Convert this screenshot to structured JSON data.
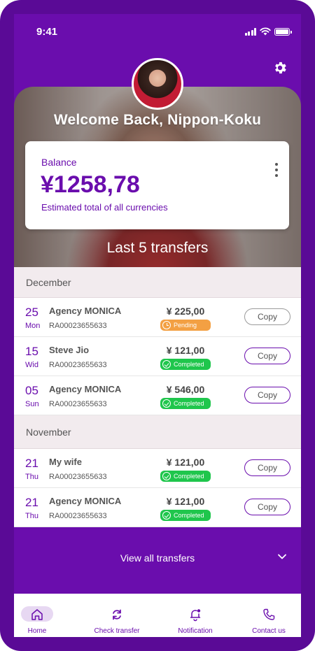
{
  "status_bar": {
    "time": "9:41"
  },
  "header": {
    "welcome": "Welcome Back, Nippon-Koku"
  },
  "balance": {
    "label": "Balance",
    "amount": "¥1258,78",
    "subtitle": "Estimated total of all currencies"
  },
  "transfers_title": "Last 5 transfers",
  "groups": [
    {
      "month": "December",
      "items": [
        {
          "day": "25",
          "weekday": "Mon",
          "name": "Agency MONICA",
          "ref": "RA00023655633",
          "amount": "¥ 225,00",
          "status": "Pending",
          "copy": "Copy"
        },
        {
          "day": "15",
          "weekday": "Wid",
          "name": "Steve Jio",
          "ref": "RA00023655633",
          "amount": "¥ 121,00",
          "status": "Completed",
          "copy": "Copy"
        },
        {
          "day": "05",
          "weekday": "Sun",
          "name": "Agency MONICA",
          "ref": "RA00023655633",
          "amount": "¥ 546,00",
          "status": "Completed",
          "copy": "Copy"
        }
      ]
    },
    {
      "month": "November",
      "items": [
        {
          "day": "21",
          "weekday": "Thu",
          "name": "My wife",
          "ref": "RA00023655633",
          "amount": "¥ 121,00",
          "status": "Completed",
          "copy": "Copy"
        },
        {
          "day": "21",
          "weekday": "Thu",
          "name": "Agency MONICA",
          "ref": "RA00023655633",
          "amount": "¥ 121,00",
          "status": "Completed",
          "copy": "Copy"
        }
      ]
    }
  ],
  "view_all": "View all transfers",
  "tabs": [
    {
      "label": "Home",
      "icon": "home-icon",
      "active": true
    },
    {
      "label": "Check transfer",
      "icon": "exchange-icon",
      "active": false
    },
    {
      "label": "Notification",
      "icon": "bell-icon",
      "active": false
    },
    {
      "label": "Contact us",
      "icon": "phone-icon",
      "active": false
    }
  ],
  "colors": {
    "brand": "#6a0dad",
    "completed": "#1fc64c",
    "pending": "#f3a043"
  }
}
